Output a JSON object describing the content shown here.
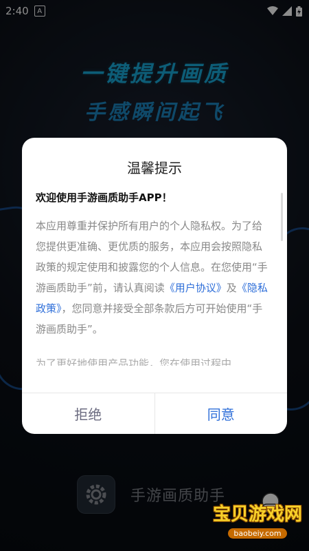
{
  "status_bar": {
    "time": "2:40",
    "notif_letter": "A"
  },
  "background": {
    "slogan_line1": "一键提升画质",
    "slogan_line2": "手感瞬间起飞",
    "app_name": "手游画质助手"
  },
  "dialog": {
    "title": "温馨提示",
    "welcome": "欢迎使用手游画质助手APP！",
    "body_part1": "本应用尊重并保护所有用户的个人隐私权。为了给您提供更准确、更优质的服务，本应用会按照隐私政策的规定使用和披露您的个人信息。在您使用“手游画质助手”前，请认真阅读",
    "link_user_agreement": "《用户协议》",
    "body_and": "及",
    "link_privacy_policy": "《隐私政策》",
    "body_part2": "，您同意并接受全部条款后方可开始使用“手游画质助手”。",
    "body_faded": "为了更好地使用产品功能，您在使用过程中",
    "reject_label": "拒绝",
    "agree_label": "同意"
  },
  "watermark": {
    "main": "宝贝游戏网",
    "url": "baobeiy.com"
  },
  "colors": {
    "accent": "#2f6fd9",
    "slogan": "#19a9d9",
    "watermark": "#f7d12a"
  }
}
